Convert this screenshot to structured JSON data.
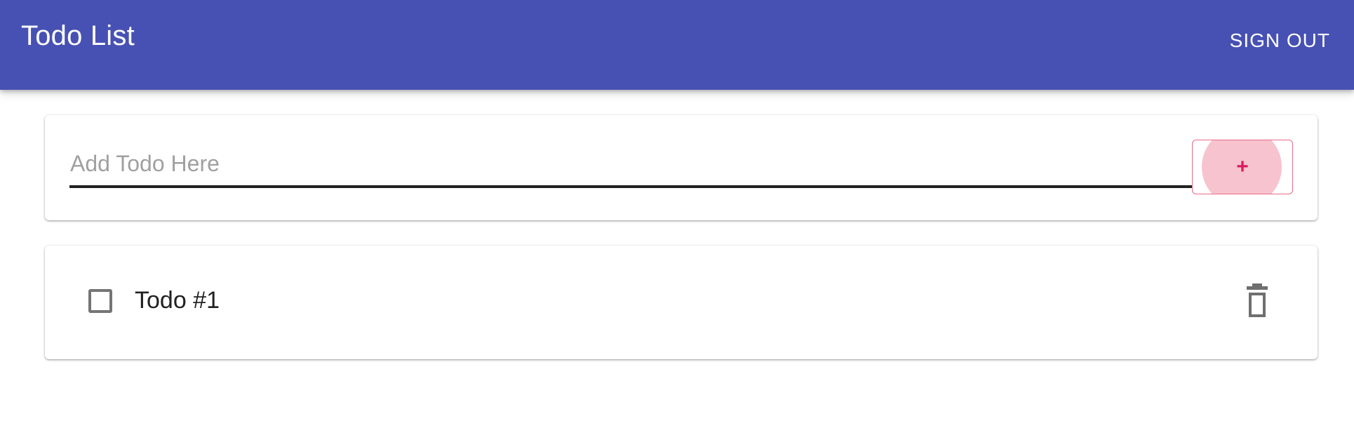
{
  "app": {
    "title": "Todo List",
    "sign_out_label": "SIGN OUT",
    "primary_color": "#4751b3",
    "accent_color": "#d81b60"
  },
  "add_todo": {
    "input_value": "",
    "placeholder": "Add Todo Here",
    "add_button_label": "+"
  },
  "todos": [
    {
      "label": "Todo #1",
      "checked": false,
      "checkbox_icon": "checkbox-blank-icon",
      "delete_icon": "trash-icon"
    }
  ]
}
